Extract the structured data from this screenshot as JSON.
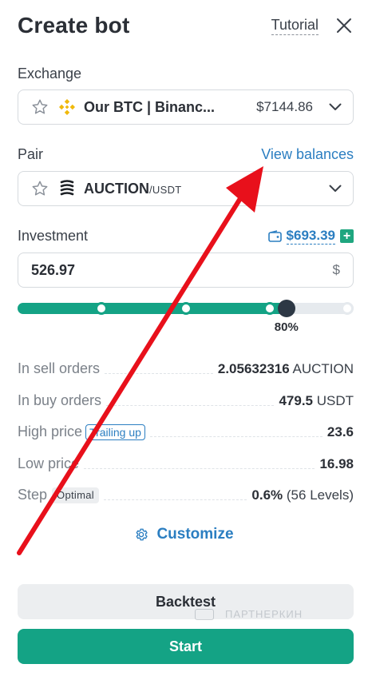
{
  "header": {
    "title": "Create bot",
    "tutorial": "Tutorial"
  },
  "exchange": {
    "label": "Exchange",
    "name": "Our BTC | Binanc...",
    "amount": "$7144.86",
    "icon": "binance-icon",
    "accent": "#f0b90b"
  },
  "pair": {
    "label": "Pair",
    "view_balances": "View balances",
    "base": "AUCTION",
    "quote": "/USDT",
    "icon": "auction-icon"
  },
  "investment": {
    "label": "Investment",
    "balance": "$693.39",
    "value": "526.97",
    "unit": "$",
    "slider_percent": 80,
    "slider_label": "80%",
    "slider_ticks": [
      0,
      25,
      50,
      75,
      100
    ]
  },
  "details": [
    {
      "key": "In sell orders",
      "value": "2.05632316",
      "unit": " AUCTION"
    },
    {
      "key": "In buy orders",
      "value": "479.5",
      "unit": " USDT"
    },
    {
      "key": "High price",
      "tag": "Trailing up",
      "value": "23.6",
      "unit": ""
    },
    {
      "key": "Low price",
      "value": "16.98",
      "unit": ""
    },
    {
      "key": "Step",
      "tag": "Optimal",
      "value": "0.6%",
      "unit": " (56 Levels)"
    }
  ],
  "actions": {
    "customize": "Customize",
    "backtest": "Backtest",
    "start": "Start"
  },
  "watermark": "ПАРТНЕРКИН",
  "colors": {
    "primary": "#14a385",
    "link": "#2b7ec1",
    "arrow": "#e8101b"
  }
}
